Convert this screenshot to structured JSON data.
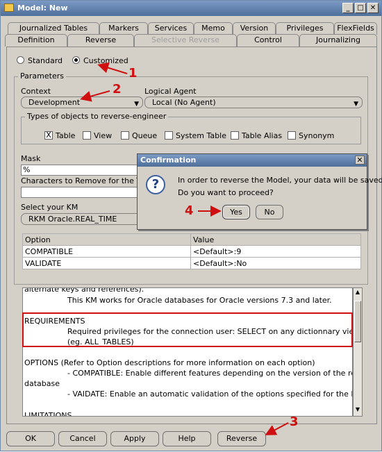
{
  "window": {
    "title": "Model: New",
    "minimize": "_",
    "maximize": "□",
    "close": "✕"
  },
  "tabs_back": [
    "Journalized Tables",
    "Markers",
    "Services",
    "Memo",
    "Version",
    "Privileges",
    "FlexFields"
  ],
  "tabs_front": [
    "Definition",
    "Reverse",
    "Selective Reverse",
    "Control",
    "Journalizing"
  ],
  "reverse": {
    "standard_label": "Standard",
    "customized_label": "Customized",
    "parameters_legend": "Parameters",
    "context_label": "Context",
    "context_value": "Development",
    "logical_agent_label": "Logical Agent",
    "logical_agent_value": "Local (No Agent)",
    "types_legend": "Types of objects to reverse-engineer",
    "types": [
      "Table",
      "View",
      "Queue",
      "System Table",
      "Table Alias",
      "Synonym"
    ],
    "table_checked_mark": "X",
    "mask_label": "Mask",
    "mask_value": "%",
    "chars_remove_label": "Characters to Remove for the Table",
    "chars_remove_value": "",
    "km_label": "Select your KM",
    "km_value": "RKM Oracle.REAL_TIME"
  },
  "options_table": {
    "headers": [
      "Option",
      "Value"
    ],
    "rows": [
      [
        "COMPATIBLE",
        "<Default>:9"
      ],
      [
        "VALIDATE",
        "<Default>:No"
      ]
    ]
  },
  "description": {
    "lines": [
      "alternate keys and references).",
      "This KM works for Oracle databases for Oracle versions 7.3 and later.",
      "REQUIREMENTS",
      "Required privileges for the connection user: SELECT on any dictionnary view ALL_*",
      "(eg. ALL_TABLES)",
      "OPTIONS (Refer to Option descriptions for more information on each option)",
      "- COMPATIBLE: Enable different features depending on the version of the reversed",
      "database",
      "- VAIDATE: Enable an automatic validation of the options specified for the KM",
      "LIMITATIONS"
    ]
  },
  "buttons": {
    "ok": "OK",
    "cancel": "Cancel",
    "apply": "Apply",
    "help": "Help",
    "reverse": "Reverse"
  },
  "dialog": {
    "title": "Confirmation",
    "close": "✕",
    "icon": "?",
    "line1": "In order to reverse the Model, your data will be saved.",
    "line2": "Do you want to proceed?",
    "yes": "Yes",
    "no": "No"
  },
  "callouts": [
    "1",
    "2",
    "3",
    "4"
  ],
  "colors": {
    "annotation": "#d01010",
    "title_bar": "#5a79a8"
  }
}
